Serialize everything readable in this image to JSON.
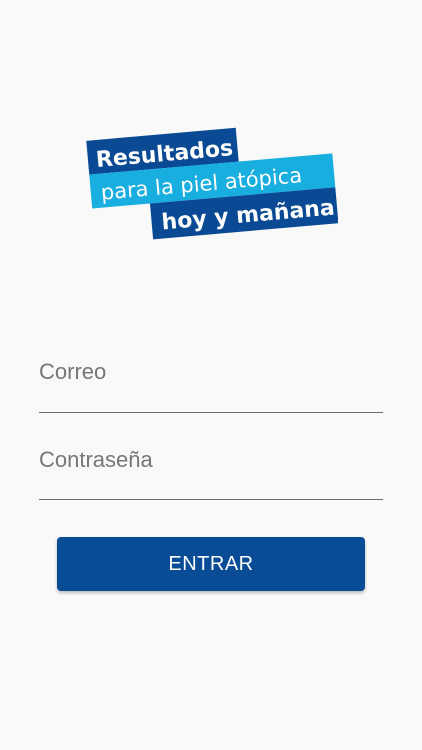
{
  "brand": {
    "logo_line1": "Resultados",
    "logo_line2": "para la piel atópica",
    "logo_line3": "hoy y mañana",
    "colors": {
      "dark_blue": "#0a4a94",
      "light_blue": "#19aee0",
      "background": "#f9f9f9"
    }
  },
  "login": {
    "email_placeholder": "Correo",
    "password_placeholder": "Contraseña",
    "submit_label": "ENTRAR"
  }
}
